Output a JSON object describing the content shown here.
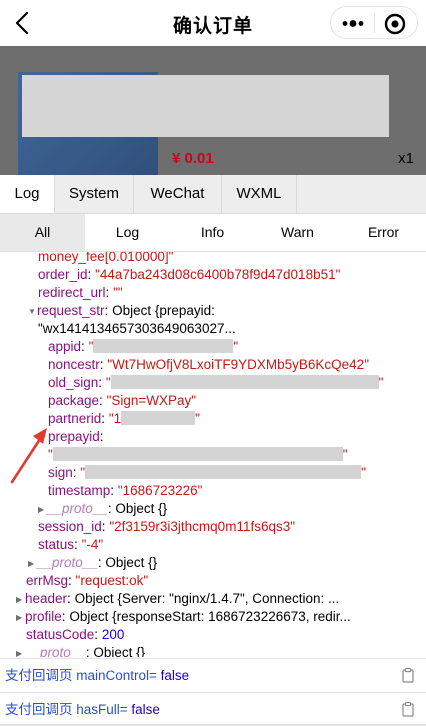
{
  "navbar": {
    "title": "确认订单"
  },
  "product": {
    "price": "¥ 0.01",
    "quantity": "x1"
  },
  "vconsole": {
    "tabs": [
      "Log",
      "System",
      "WeChat",
      "WXML"
    ],
    "subtabs": [
      "All",
      "Log",
      "Info",
      "Warn",
      "Error"
    ]
  },
  "log": {
    "money_fee_cont": "money_fee[0.010000]\"",
    "order_id_key": "order_id",
    "order_id_val": "\"44a7ba243d08c6400b78f9d47d018b51\"",
    "redirect_url_key": "redirect_url",
    "redirect_url_val": "\"\"",
    "request_str_key": "request_str",
    "request_str_summary": "Object {prepayid:",
    "request_str_summary2": "\"wx141413465730364906302​7...",
    "appid_key": "appid",
    "appid_prefix": "\"",
    "appid_suffix": "\"",
    "noncestr_key": "noncestr",
    "noncestr_val": "\"Wt7HwOfjV8LxoiTF9YDXMb5yB6KcQe42\"",
    "old_sign_key": "old_sign",
    "package_key": "package",
    "package_val": "\"Sign=WXPay\"",
    "partnerid_key": "partnerid",
    "partnerid_prefix": "\"1",
    "prepayid_key": "prepayid",
    "sign_key": "sign",
    "timestamp_key": "timestamp",
    "timestamp_val": "\"1686723226\"",
    "proto_key": "__proto__",
    "proto_val": "Object {}",
    "session_id_key": "session_id",
    "session_id_val": "\"2f3159r3i3jthcmq0m11fs6qs3\"",
    "status_key": "status",
    "status_val": "\"-4\"",
    "errMsg_key": "errMsg",
    "errMsg_val": "\"request:ok\"",
    "header_key": "header",
    "header_val": "Object {Server: \"nginx/1.4.7\", Connection: ...",
    "profile_key": "profile",
    "profile_val": "Object {responseStart: 1686723226673, redir...",
    "statusCode_key": "statusCode",
    "statusCode_val": "200",
    "colon": ":"
  },
  "console_rows": [
    {
      "label": "支付回调页 mainControl= ",
      "value": "false"
    },
    {
      "label": "支付回调页 hasFull= ",
      "value": "false"
    }
  ],
  "colors": {
    "key": "#881280",
    "string": "#c41a16",
    "number": "#1c00cf",
    "price": "#d0021b",
    "arrow": "#e23a2e"
  }
}
